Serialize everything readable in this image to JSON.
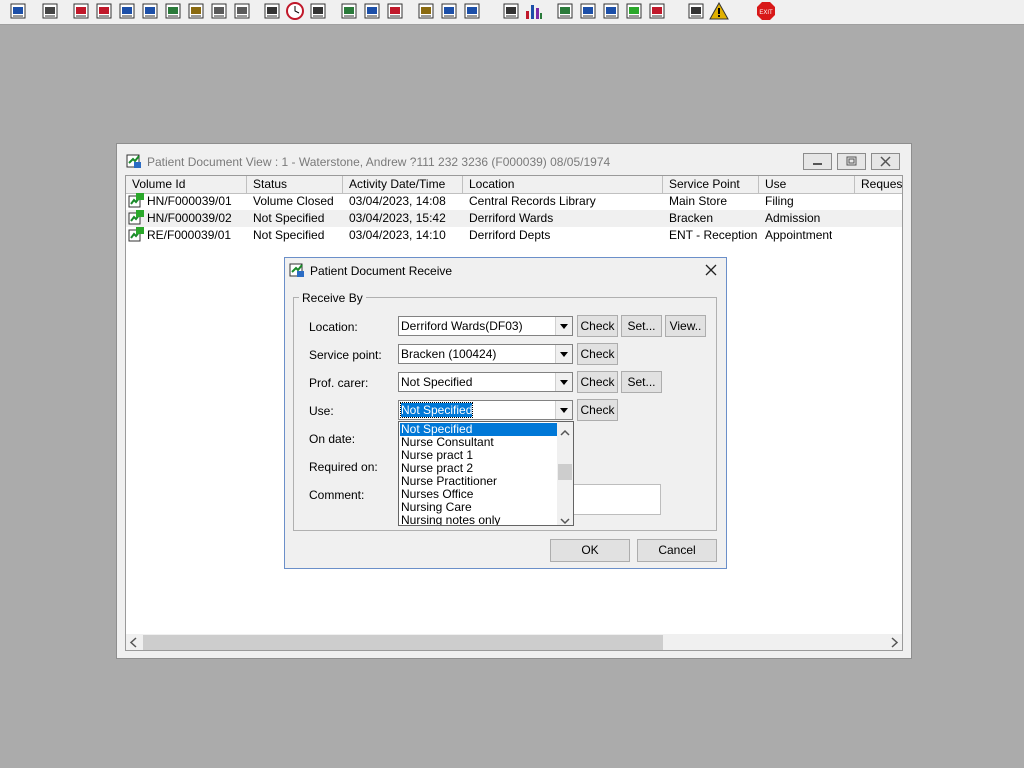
{
  "toolbar": {
    "icons": [
      "patient-icon",
      "print-icon",
      "book-icon",
      "edit-book-icon",
      "monitor-icon",
      "m-icon",
      "clinician-icon",
      "notepad-icon",
      "folders-icon",
      "flag-icon",
      "envelope-icon",
      "clock-icon",
      "screen-icon",
      "book-green-icon",
      "messages-icon",
      "history-icon",
      "notes-icon",
      "bed-icon",
      "transfer-icon",
      "document-icon",
      "bar-chart-icon",
      "globe-icon",
      "checklist-icon",
      "check-doc-icon",
      "check-green-icon",
      "check-red-icon",
      "swap-icon",
      "warning-icon",
      "exit-icon"
    ],
    "exit_label": "EXIT"
  },
  "main_window": {
    "title": "Patient Document View : 1 - Waterstone, Andrew ?111 232 3236 (F000039) 08/05/1974",
    "columns": [
      "Volume Id",
      "Status",
      "Activity Date/Time",
      "Location",
      "Service Point",
      "Use",
      "Requeste"
    ],
    "rows": [
      {
        "volume_id": "HN/F000039/01",
        "status": "Volume Closed",
        "activity": "03/04/2023, 14:08",
        "location": "Central Records Library",
        "service_point": "Main Store",
        "use": "Filing"
      },
      {
        "volume_id": "HN/F000039/02",
        "status": "Not Specified",
        "activity": "03/04/2023, 15:42",
        "location": "Derriford Wards",
        "service_point": "Bracken",
        "use": "Admission"
      },
      {
        "volume_id": "RE/F000039/01",
        "status": "Not Specified",
        "activity": "03/04/2023, 14:10",
        "location": "Derriford Depts",
        "service_point": "ENT - Reception",
        "use": "Appointment"
      }
    ]
  },
  "dialog": {
    "title": "Patient Document Receive",
    "group_label": "Receive By",
    "location_label": "Location:",
    "location_value": "Derriford Wards(DF03)",
    "service_point_label": "Service point:",
    "service_point_value": "Bracken (100424)",
    "prof_carer_label": "Prof. carer:",
    "prof_carer_value": "Not Specified",
    "use_label": "Use:",
    "use_value": "Not Specified",
    "on_date_label": "On date:",
    "required_on_label": "Required on:",
    "comment_label": "Comment:",
    "check_label": "Check",
    "set_label": "Set...",
    "view_label": "View..",
    "ok_label": "OK",
    "cancel_label": "Cancel",
    "use_options": [
      "Not Specified",
      "Nurse Consultant",
      "Nurse pract 1",
      "Nurse pract 2",
      "Nurse Practitioner",
      "Nurses Office",
      "Nursing Care",
      "Nursing notes only"
    ],
    "selected_option": "Not Specified"
  },
  "colors": {
    "desktop": "#ababab",
    "selection": "#0078d7",
    "dialog_border": "#6b8fc9"
  }
}
